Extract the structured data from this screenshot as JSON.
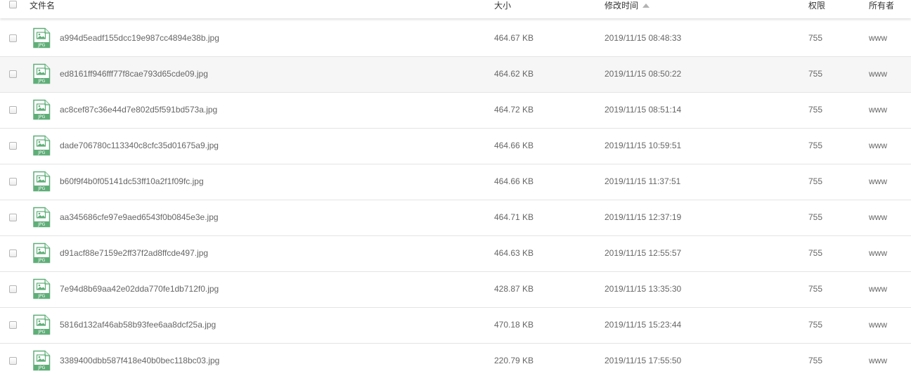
{
  "header": {
    "name": "文件名",
    "size": "大小",
    "mtime": "修改时间",
    "perm": "权限",
    "owner": "所有者"
  },
  "icons": {
    "file_type_label": "JPG",
    "file_icon_color": "#5fae78",
    "sort": "sort-ascending-icon"
  },
  "files": [
    {
      "name": "a994d5eadf155dcc19e987cc4894e38b.jpg",
      "size": "464.67 KB",
      "mtime": "2019/11/15 08:48:33",
      "perm": "755",
      "owner": "www"
    },
    {
      "name": "ed8161ff946fff77f8cae793d65cde09.jpg",
      "size": "464.62 KB",
      "mtime": "2019/11/15 08:50:22",
      "perm": "755",
      "owner": "www"
    },
    {
      "name": "ac8cef87c36e44d7e802d5f591bd573a.jpg",
      "size": "464.72 KB",
      "mtime": "2019/11/15 08:51:14",
      "perm": "755",
      "owner": "www"
    },
    {
      "name": "dade706780c113340c8cfc35d01675a9.jpg",
      "size": "464.66 KB",
      "mtime": "2019/11/15 10:59:51",
      "perm": "755",
      "owner": "www"
    },
    {
      "name": "b60f9f4b0f05141dc53ff10a2f1f09fc.jpg",
      "size": "464.66 KB",
      "mtime": "2019/11/15 11:37:51",
      "perm": "755",
      "owner": "www"
    },
    {
      "name": "aa345686cfe97e9aed6543f0b0845e3e.jpg",
      "size": "464.71 KB",
      "mtime": "2019/11/15 12:37:19",
      "perm": "755",
      "owner": "www"
    },
    {
      "name": "d91acf88e7159e2ff37f2ad8ffcde497.jpg",
      "size": "464.63 KB",
      "mtime": "2019/11/15 12:55:57",
      "perm": "755",
      "owner": "www"
    },
    {
      "name": "7e94d8b69aa42e02dda770fe1db712f0.jpg",
      "size": "428.87 KB",
      "mtime": "2019/11/15 13:35:30",
      "perm": "755",
      "owner": "www"
    },
    {
      "name": "5816d132af46ab58b93fee6aa8dcf25a.jpg",
      "size": "470.18 KB",
      "mtime": "2019/11/15 15:23:44",
      "perm": "755",
      "owner": "www"
    },
    {
      "name": "3389400dbb587f418e40b0bec118bc03.jpg",
      "size": "220.79 KB",
      "mtime": "2019/11/15 17:55:50",
      "perm": "755",
      "owner": "www"
    }
  ]
}
